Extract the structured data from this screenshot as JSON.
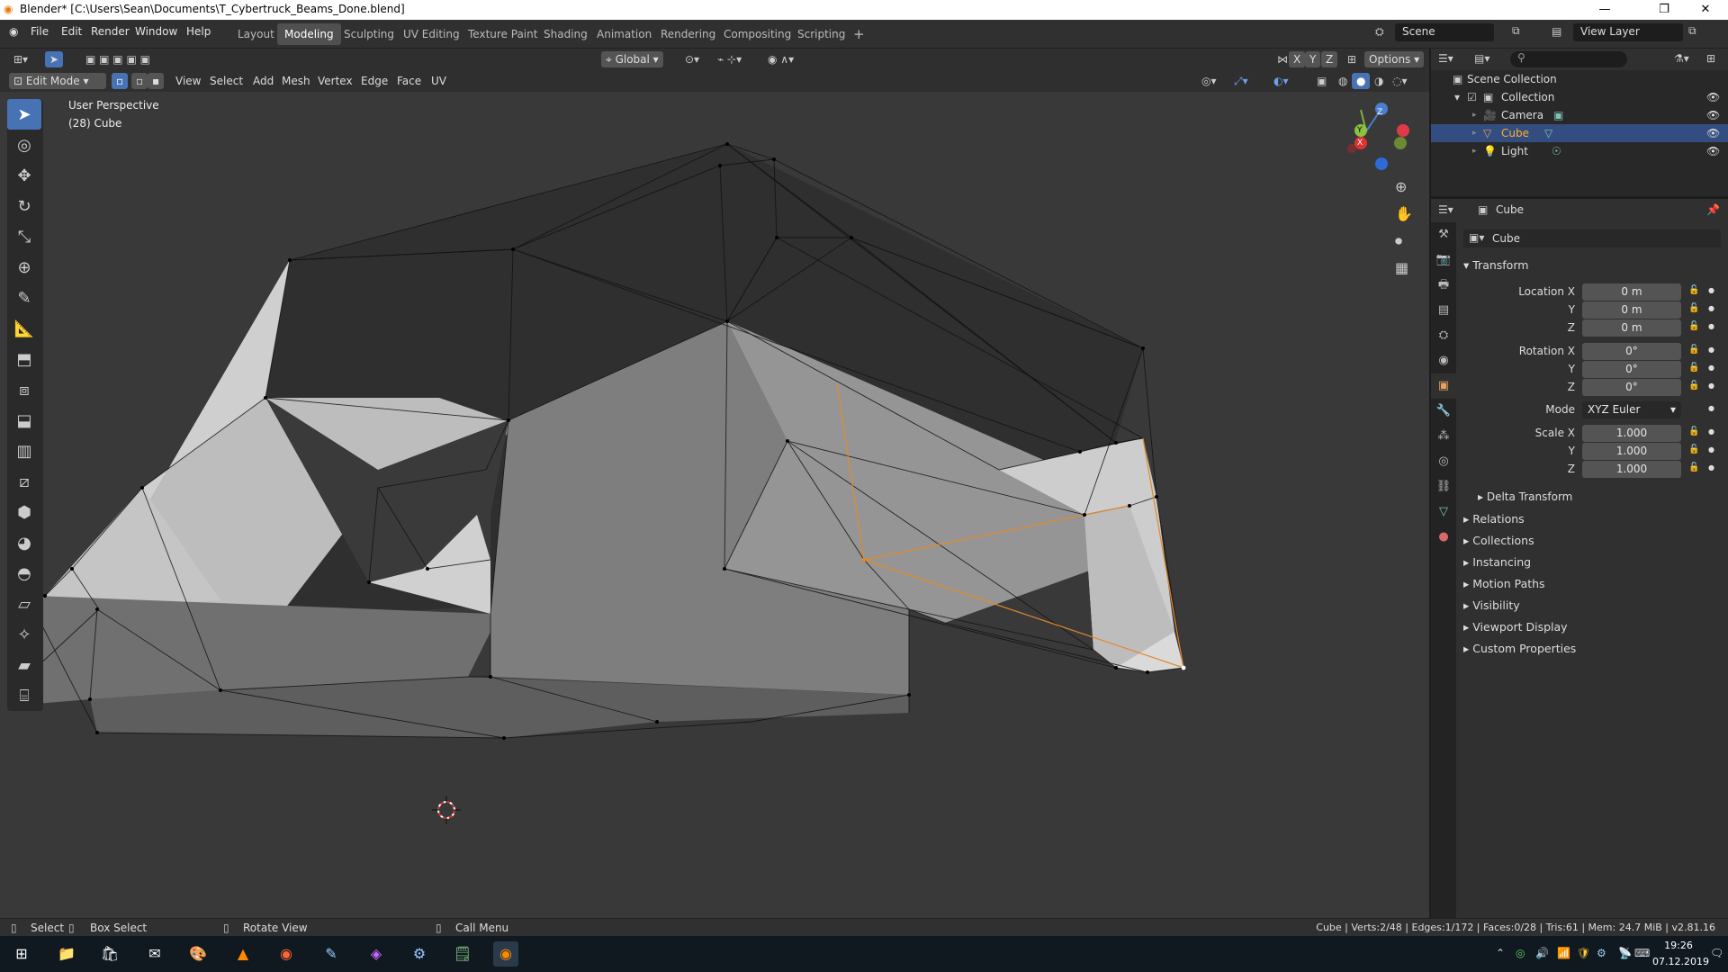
{
  "title": "Blender* [C:\\Users\\Sean\\Documents\\T_Cybertruck_Beams_Done.blend]",
  "menu": [
    "File",
    "Edit",
    "Render",
    "Window",
    "Help"
  ],
  "workspaces": [
    "Layout",
    "Modeling",
    "Sculpting",
    "UV Editing",
    "Texture Paint",
    "Shading",
    "Animation",
    "Rendering",
    "Compositing",
    "Scripting"
  ],
  "active_workspace": "Modeling",
  "scene_label": "Scene",
  "view_layer_label": "View Layer",
  "header": {
    "transform_orientation": "Global",
    "options_label": "Options",
    "axis_x": "X",
    "axis_y": "Y",
    "axis_z": "Z",
    "mode": "Edit Mode",
    "view_menu": [
      "View",
      "Select",
      "Add",
      "Mesh",
      "Vertex",
      "Edge",
      "Face",
      "UV"
    ]
  },
  "viewport": {
    "perspective": "User Perspective",
    "object_info": "(28) Cube",
    "gizmo_x": "X",
    "gizmo_y": "Y",
    "gizmo_z": "Z"
  },
  "outliner": {
    "root": "Scene Collection",
    "collection": "Collection",
    "items": [
      "Camera",
      "Cube",
      "Light"
    ]
  },
  "properties": {
    "header_object": "Cube",
    "name_field": "Cube",
    "transform_label": "Transform",
    "location_label": "Location X",
    "rotation_label": "Rotation X",
    "mode_label": "Mode",
    "scale_label": "Scale X",
    "y": "Y",
    "z": "Z",
    "location": [
      "0 m",
      "0 m",
      "0 m"
    ],
    "rotation": [
      "0°",
      "0°",
      "0°"
    ],
    "rotation_mode": "XYZ Euler",
    "scale": [
      "1.000",
      "1.000",
      "1.000"
    ],
    "panels": [
      "Delta Transform",
      "Relations",
      "Collections",
      "Instancing",
      "Motion Paths",
      "Visibility",
      "Viewport Display",
      "Custom Properties"
    ]
  },
  "status": {
    "select": "Select",
    "box_select": "Box Select",
    "rotate_view": "Rotate View",
    "call_menu": "Call Menu",
    "stats": "Cube | Verts:2/48 | Edges:1/172 | Faces:0/28 | Tris:61 | Mem: 24.7 MiB | v2.81.16"
  },
  "taskbar": {
    "time": "19:26",
    "date": "07.12.2019"
  },
  "colors": {
    "accent": "#4772b3",
    "selection_orange": "#e08a2a",
    "viewport_bg": "#393939"
  }
}
